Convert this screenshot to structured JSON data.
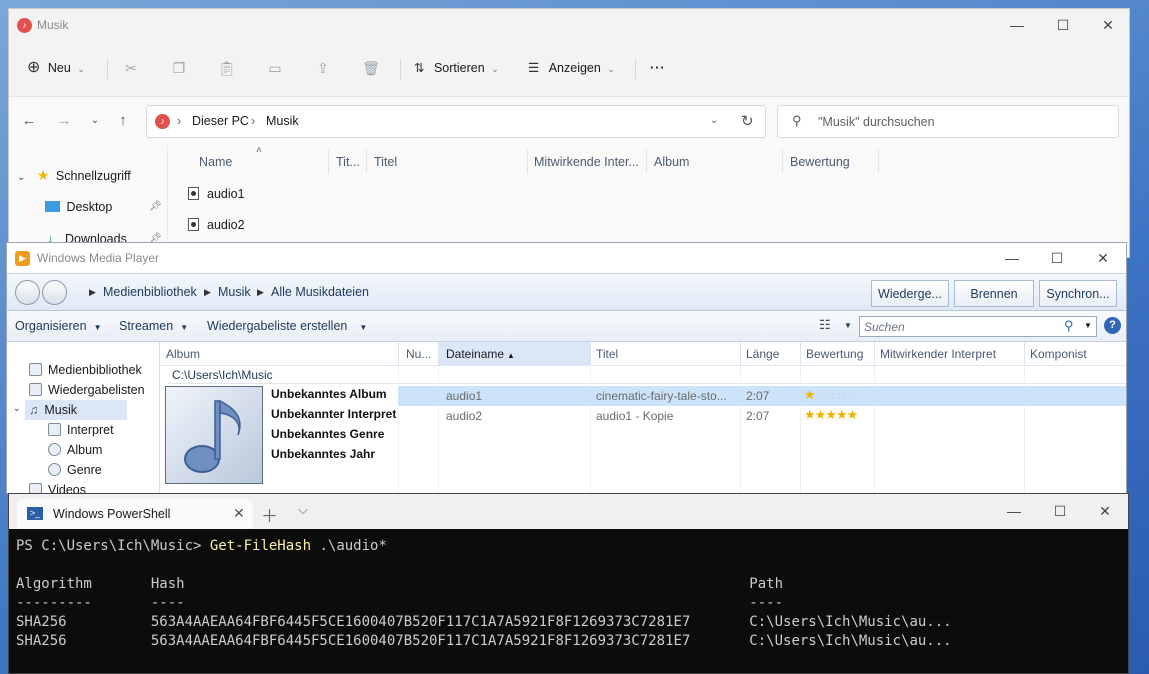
{
  "explorer": {
    "title": "Musik",
    "toolbar": {
      "new_label": "Neu",
      "sort_label": "Sortieren",
      "view_label": "Anzeigen",
      "more_label": "···"
    },
    "address": {
      "root": "Dieser PC",
      "folder": "Musik"
    },
    "search_placeholder": "\"Musik\" durchsuchen",
    "nav": {
      "quick_access": "Schnellzugriff",
      "desktop": "Desktop",
      "downloads": "Downloads"
    },
    "columns": [
      "Name",
      "Tit...",
      "Titel",
      "Mitwirkende Inter...",
      "Album",
      "Bewertung"
    ],
    "files": [
      "audio1",
      "audio2"
    ]
  },
  "wmp": {
    "title": "Windows Media Player",
    "breadcrumb": [
      "Medienbibliothek",
      "Musik",
      "Alle Musikdateien"
    ],
    "tabs": {
      "play": "Wiederge...",
      "burn": "Brennen",
      "sync": "Synchron..."
    },
    "commands": {
      "organize": "Organisieren",
      "stream": "Streamen",
      "create_playlist": "Wiedergabeliste erstellen"
    },
    "search_placeholder": "Suchen",
    "sidebar": {
      "library": "Medienbibliothek",
      "playlists": "Wiedergabelisten",
      "music": "Musik",
      "artist": "Interpret",
      "album": "Album",
      "genre": "Genre",
      "videos": "Videos"
    },
    "columns": {
      "album": "Album",
      "num": "Nu...",
      "filename": "Dateiname",
      "title": "Titel",
      "length": "Länge",
      "rating": "Bewertung",
      "contributing_artist": "Mitwirkender Interpret",
      "composer": "Komponist"
    },
    "folder_path": "C:\\Users\\Ich\\Music",
    "album_info": {
      "album": "Unbekanntes Album",
      "artist": "Unbekannter Interpret",
      "genre": "Unbekanntes Genre",
      "year": "Unbekanntes Jahr"
    },
    "tracks": [
      {
        "filename": "audio1",
        "title": "cinematic-fairy-tale-sto...",
        "length": "2:07",
        "rating_stars": 1
      },
      {
        "filename": "audio2",
        "title": "audio1 - Kopie",
        "length": "2:07",
        "rating_stars": 5
      }
    ]
  },
  "powershell": {
    "tab_label": "Windows PowerShell",
    "prompt": "PS C:\\Users\\Ich\\Music> ",
    "command": "Get-FileHash",
    "argument": " .\\audio*",
    "header": "Algorithm       Hash                                                                   Path",
    "underline": "---------       ----                                                                   ----",
    "rows": [
      "SHA256          563A4AAEAA64FBF6445F5CE1600407B520F117C1A7A5921F8F1269373C7281E7       C:\\Users\\Ich\\Music\\au...",
      "SHA256          563A4AAEAA64FBF6445F5CE1600407B520F117C1A7A5921F8F1269373C7281E7       C:\\Users\\Ich\\Music\\au..."
    ]
  },
  "colors": {
    "accent": "#0067c0",
    "selection": "#cce3f9",
    "terminal_bg": "#0c0c0c",
    "terminal_cmd": "#f9f1a5"
  }
}
